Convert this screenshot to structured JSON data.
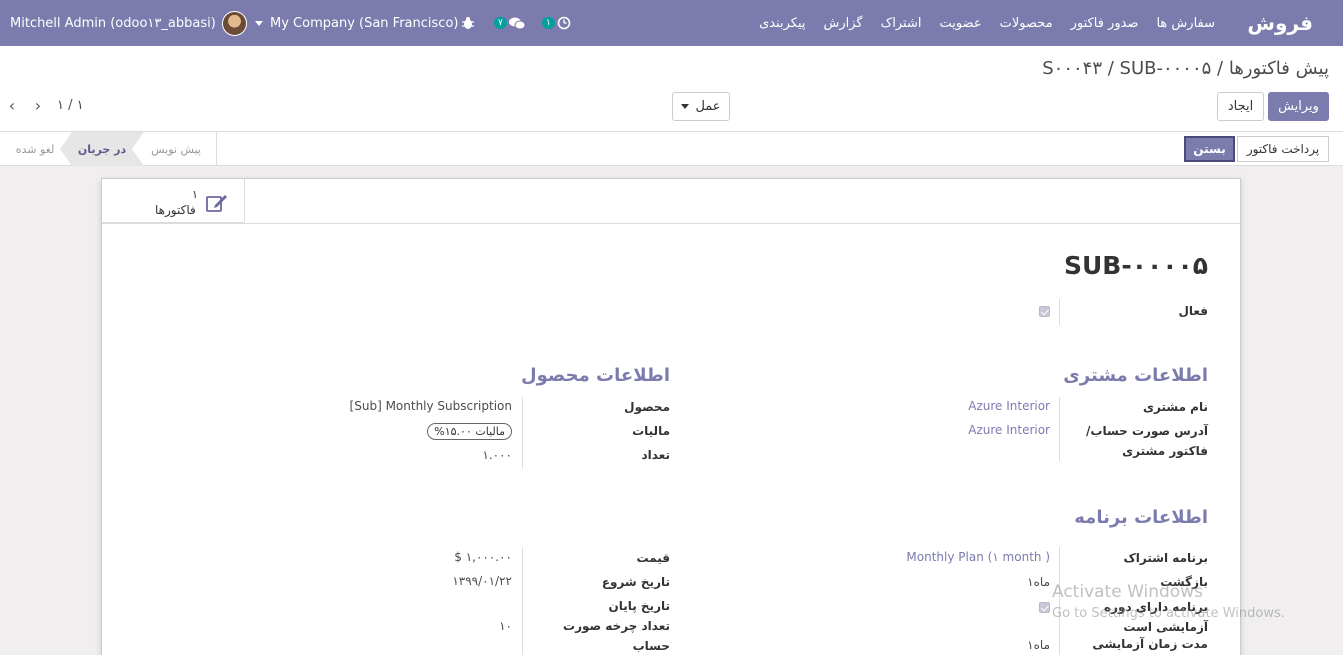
{
  "navbar": {
    "brand": "فروش",
    "menus": [
      "سفارش ها",
      "صدور فاکتور",
      "محصولات",
      "عضویت",
      "اشتراک",
      "گزارش",
      "پیکربندی"
    ],
    "user": "Mitchell Admin (odoo۱۳_abbasi)",
    "company": "My Company (San Francisco)",
    "chat_badge": "۷",
    "activity_badge": "۱",
    "bug_icon": "bug-icon",
    "chat_icon": "chat-icon",
    "activity_icon": "clock-icon"
  },
  "control": {
    "breadcrumb_root": "پیش فاکتورها",
    "breadcrumb_mid": "S۰۰۰۴۳",
    "breadcrumb_current": "SUB-۰۰۰۰۵",
    "sep": " / ",
    "edit_label": "ویرایش",
    "create_label": "ایجاد",
    "action_label": "عمل",
    "pager": "۱ / ۱"
  },
  "statusbar": {
    "pay_label": "پرداخت فاکتور",
    "close_label": "بستن",
    "stages": [
      "پیش نویس",
      "در جریان",
      "لغو شده"
    ],
    "active_stage": "در جریان"
  },
  "smart_button": {
    "count": "۱",
    "label": "فاکتورها"
  },
  "record": {
    "title": "SUB-۰۰۰۰۵",
    "active_label": "فعال",
    "active_value": true,
    "customer_group": "اطلاعات مشتری",
    "product_group": "اطلاعات محصول",
    "plan_group": "اطلاعات برنامه",
    "customer_name_label": "نام مشتری",
    "customer_name": "Azure Interior",
    "invoice_address_label": "آدرس صورت حساب/ فاکتور مشتری",
    "invoice_address": "Azure Interior",
    "product_label": "محصول",
    "product": "[Sub] Monthly Subscription",
    "taxes_label": "مالیات",
    "tax_tag": "مالیات ۱۵.۰۰%",
    "quantity_label": "تعداد",
    "quantity": "۱.۰۰۰",
    "subscription_plan_label": "برنامه اشتراک",
    "subscription_plan": "Monthly Plan (۱ month )",
    "recurrence_label": "بازگشت",
    "recurrence": "۱ماه",
    "trial_label": "برنامه دارای دوره آزمایشی است",
    "trial_value": true,
    "trial_duration_label": "مدت زمان آزمایشی",
    "trial_duration": "۱ماه",
    "price_label": "قیمت",
    "price": "$ ۱,۰۰۰.۰۰",
    "start_date_label": "تاریخ شروع",
    "start_date": "۱۳۹۹/۰۱/۲۲",
    "end_date_label": "تاریخ پایان",
    "billing_cycles_label": "تعداد چرخه صورت حساب",
    "billing_cycles": "۱۰"
  },
  "watermark": {
    "line1": "Activate Windows",
    "line2": "Go to Settings to activate Windows."
  }
}
